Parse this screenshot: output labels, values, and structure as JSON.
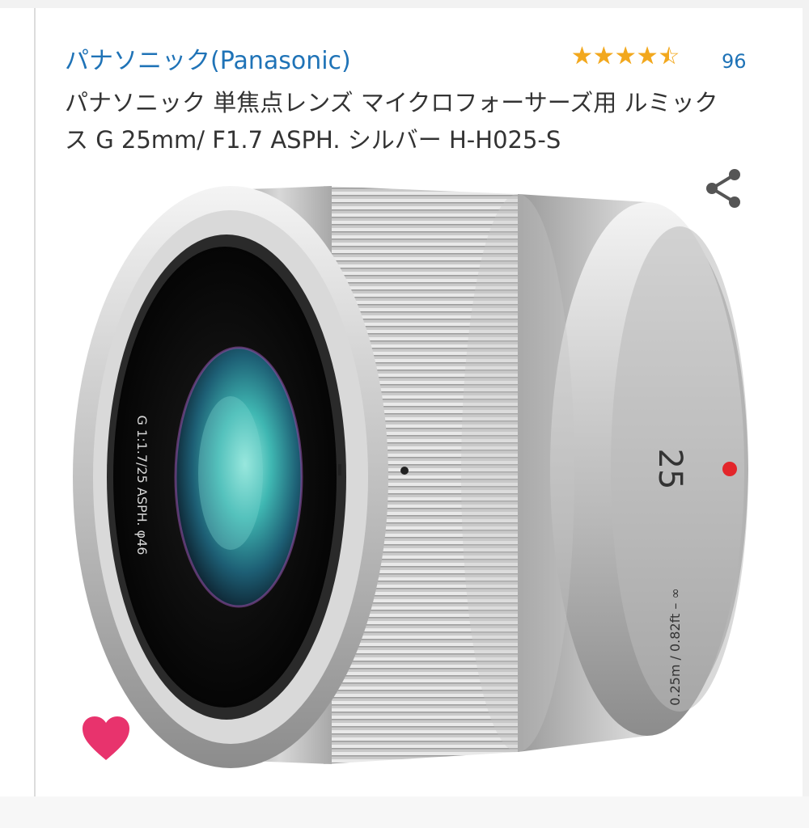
{
  "brand": "パナソニック(Panasonic)",
  "rating": {
    "stars": 4.5,
    "max": 5,
    "review_count": "96"
  },
  "title": "パナソニック 単焦点レンズ マイクロフォーサーズ用 ルミックス G 25mm/ F1.7 ASPH. シルバー H-H025-S",
  "image": {
    "alt": "lens-product-image",
    "lens_markings": {
      "front_ring": "G  1:1.7/25  ASPH.  φ46",
      "focal_length": "25",
      "distance_scale": "0.25m / 0.82ft – ∞"
    }
  },
  "icons": {
    "share": "share-icon",
    "favorite": "heart-icon"
  },
  "colors": {
    "link_blue": "#1f73b7",
    "star": "#f2a81e",
    "heart": "#e8336d",
    "text": "#333333"
  }
}
